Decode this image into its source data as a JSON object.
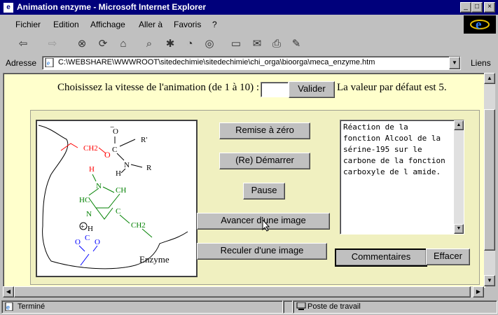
{
  "window": {
    "title": "Animation enzyme - Microsoft Internet Explorer",
    "controls": {
      "minimize": "_",
      "maximize": "□",
      "close": "×"
    }
  },
  "menu": [
    "Fichier",
    "Edition",
    "Affichage",
    "Aller à",
    "Favoris",
    "?"
  ],
  "toolbar": {
    "icons": [
      "back-icon",
      "forward-icon",
      "stop-icon",
      "refresh-icon",
      "home-icon",
      "search-icon",
      "favorites-icon",
      "history-icon",
      "channels-icon",
      "fullscreen-icon",
      "mail-icon",
      "print-icon",
      "edit-icon"
    ]
  },
  "address": {
    "label": "Adresse",
    "value": "C:\\WEBSHARE\\WWWROOT\\sitedechimie\\sitedechimie\\chi_orga\\bioorga\\meca_enzyme.htm",
    "links_label": "Liens"
  },
  "page": {
    "speed_prompt": "Choisissez la vitesse de l'animation (de 1 à 10) :",
    "speed_value": "",
    "validate_label": "Valider",
    "default_note": "La valeur par défaut est 5.",
    "buttons": {
      "reset": "Remise à zéro",
      "start": "(Re) Démarrer",
      "pause": "Pause",
      "next": "Avancer d'une image",
      "prev": "Reculer d'une image",
      "comments": "Commentaires",
      "clear": "Effacer"
    },
    "comment_text": "Réaction de la fonction Alcool de la sérine-195 sur le carbone de la fonction carboxyle de l amide.",
    "molecule": {
      "labels": [
        "O",
        "R'",
        "C",
        "N",
        "H",
        "R",
        "O",
        "CH2",
        "H",
        "N",
        "CH",
        "HC",
        "N",
        "C",
        "CH2",
        "H",
        "O",
        "O",
        "C",
        "Enzyme"
      ],
      "minus_sign": "−",
      "plus_sign": "+",
      "colors": {
        "serine": "#ff0000",
        "histidine": "#008000",
        "aspartate": "#0000ff"
      }
    }
  },
  "status": {
    "left": "Terminé",
    "right": "Poste de travail"
  }
}
